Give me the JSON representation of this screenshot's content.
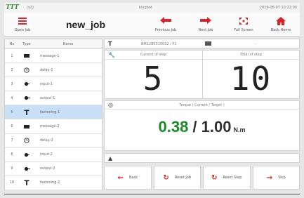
{
  "status_bar": {
    "logo": "TTT",
    "version": "(v3)",
    "user": "kingbot",
    "datetime": "2019-08-07 10:22:00"
  },
  "toolbar": {
    "open_job": "Open Job",
    "job_title": "new_job",
    "previous_job": "Previous Job",
    "next_job": "Next Job",
    "full_screen": "Full Screen",
    "back_home": "Back Home"
  },
  "job_list": {
    "headers": {
      "no": "No",
      "type": "Type",
      "name": "Name"
    },
    "rows": [
      {
        "no": "1",
        "type_icon": "message-icon",
        "name": "message-1",
        "selected": false
      },
      {
        "no": "2",
        "type_icon": "delay-clock-icon",
        "name": "delay-1",
        "selected": false
      },
      {
        "no": "3",
        "type_icon": "input-icon",
        "name": "input-1",
        "selected": false
      },
      {
        "no": "4",
        "type_icon": "output-icon",
        "name": "output-1",
        "selected": false
      },
      {
        "no": "5",
        "type_icon": "fastening-icon",
        "name": "fastening-1",
        "selected": true
      },
      {
        "no": "6",
        "type_icon": "message-icon",
        "name": "message-2",
        "selected": false
      },
      {
        "no": "7",
        "type_icon": "delay-clock-icon",
        "name": "delay-2",
        "selected": false
      },
      {
        "no": "8",
        "type_icon": "input-icon",
        "name": "input-2",
        "selected": false
      },
      {
        "no": "9",
        "type_icon": "output-icon",
        "name": "output-2",
        "selected": false
      },
      {
        "no": "10",
        "type_icon": "fastening-icon",
        "name": "fastening-2",
        "selected": false
      }
    ]
  },
  "program": {
    "value": "BM12803100S2 / P1",
    "memory_value": "-"
  },
  "steps": {
    "current_label": "Current of step",
    "current_value": "5",
    "total_label": "Total of step",
    "total_value": "10"
  },
  "torque": {
    "label": "Torque ( Current / Target )",
    "current": "0.38",
    "separator": " / ",
    "target": "1.00",
    "unit": "N.m"
  },
  "actions": {
    "back": "Back",
    "reset_job": "Reset Job",
    "reset_step": "Reset Step",
    "skip": "Skip"
  },
  "colors": {
    "accent_red": "#d9232a",
    "torque_green": "#1c8a2c",
    "selected_row": "#c9def7",
    "logo_green": "#3f8e3f"
  }
}
